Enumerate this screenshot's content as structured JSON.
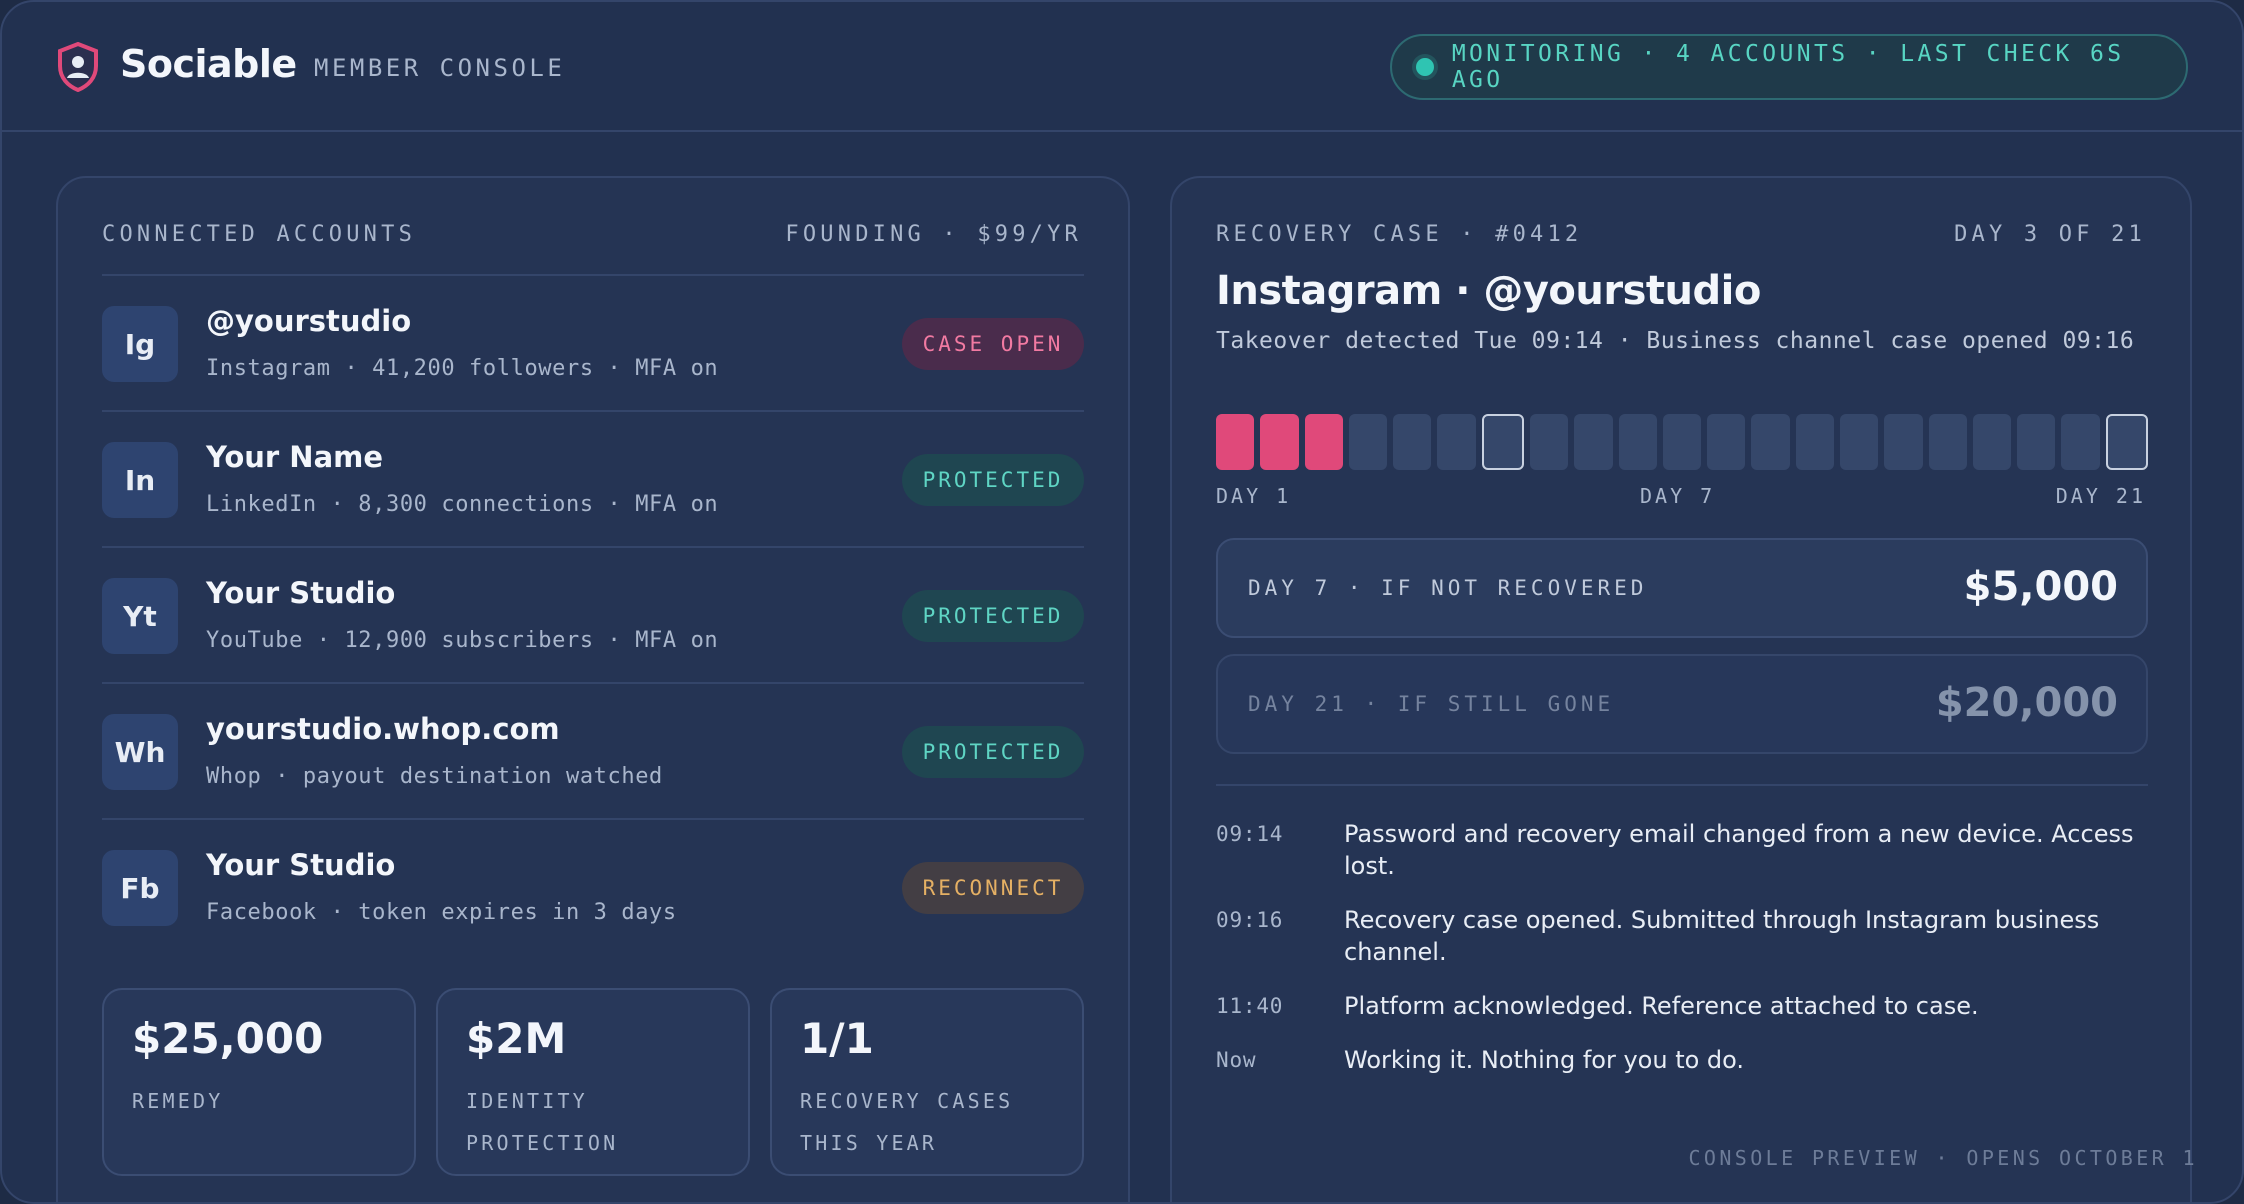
{
  "header": {
    "brand": "Sociable",
    "console_label": "MEMBER CONSOLE",
    "status": "MONITORING · 4 ACCOUNTS · LAST CHECK 6S AGO"
  },
  "accounts_panel": {
    "title": "CONNECTED ACCOUNTS",
    "plan": "FOUNDING · $99/YR",
    "accounts": [
      {
        "icon": "Ig",
        "name": "@yourstudio",
        "meta": "Instagram · 41,200 followers · MFA on",
        "status": "CASE OPEN"
      },
      {
        "icon": "In",
        "name": "Your Name",
        "meta": "LinkedIn · 8,300 connections · MFA on",
        "status": "PROTECTED"
      },
      {
        "icon": "Yt",
        "name": "Your Studio",
        "meta": "YouTube · 12,900 subscribers · MFA on",
        "status": "PROTECTED"
      },
      {
        "icon": "Wh",
        "name": "yourstudio.whop.com",
        "meta": "Whop · payout destination watched",
        "status": "PROTECTED"
      },
      {
        "icon": "Fb",
        "name": "Your Studio",
        "meta": "Facebook · token expires in 3 days",
        "status": "RECONNECT"
      }
    ],
    "stats": [
      {
        "value": "$25,000",
        "label": "REMEDY"
      },
      {
        "value": "$2M",
        "label": "IDENTITY PROTECTION"
      },
      {
        "value": "1/1",
        "label": "RECOVERY CASES THIS YEAR"
      }
    ]
  },
  "case_panel": {
    "title": "RECOVERY CASE · #0412",
    "progress": "DAY 3 OF 21",
    "heading": "Instagram · @yourstudio",
    "subheading": "Takeover detected Tue 09:14 · Business channel case opened 09:16",
    "days_total": 21,
    "days_elapsed": 3,
    "axis": {
      "start": "DAY 1",
      "mid": "DAY 7",
      "end": "DAY 21"
    },
    "payouts": [
      {
        "label": "DAY 7 · IF NOT RECOVERED",
        "amount": "$5,000"
      },
      {
        "label": "DAY 21 · IF STILL GONE",
        "amount": "$20,000"
      }
    ],
    "log": [
      {
        "time": "09:14",
        "text": "Password and recovery email changed from a new device. Access lost."
      },
      {
        "time": "09:16",
        "text": "Recovery case opened. Submitted through Instagram business channel."
      },
      {
        "time": "11:40",
        "text": "Platform acknowledged. Reference attached to case."
      },
      {
        "time": "Now",
        "text": "Working it. Nothing for you to do."
      }
    ],
    "footer": "CONSOLE PREVIEW · OPENS OCTOBER 1"
  }
}
